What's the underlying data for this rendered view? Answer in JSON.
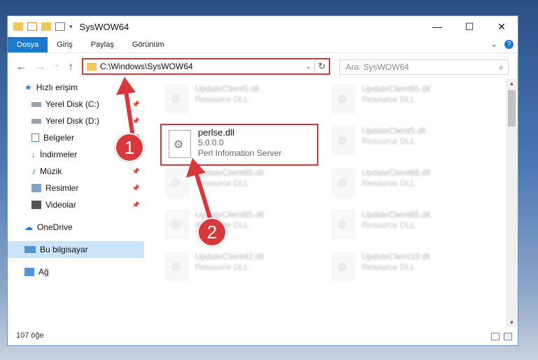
{
  "window": {
    "title": "SysWOW64",
    "controls": {
      "minimize": "—",
      "maximize": "☐",
      "close": "✕"
    }
  },
  "ribbon": {
    "tabs": [
      "Dosya",
      "Giriş",
      "Paylaş",
      "Görünüm"
    ],
    "expand": "⌄",
    "help": "?"
  },
  "nav": {
    "back": "←",
    "forward": "→",
    "recent": "⌄",
    "up": "↑"
  },
  "address": {
    "path": "C:\\Windows\\SysWOW64",
    "dropdown": "⌄",
    "refresh": "↻"
  },
  "search": {
    "placeholder": "Ara: SysWOW64",
    "icon": "search-icon"
  },
  "sidebar": {
    "quick_access": "Hızlı erişim",
    "items": [
      {
        "label": "Yerel Disk (C:)",
        "icon": "drive-icon",
        "pinned": true
      },
      {
        "label": "Yerel Disk (D:)",
        "icon": "drive-icon",
        "pinned": true
      },
      {
        "label": "Belgeler",
        "icon": "documents-icon",
        "pinned": true
      },
      {
        "label": "İndirmeler",
        "icon": "download-icon",
        "pinned": true
      },
      {
        "label": "Müzik",
        "icon": "music-icon",
        "pinned": true
      },
      {
        "label": "Resimler",
        "icon": "pictures-icon",
        "pinned": true
      },
      {
        "label": "Videolar",
        "icon": "videos-icon",
        "pinned": true
      }
    ],
    "onedrive": "OneDrive",
    "this_pc": "Bu bilgisayar",
    "network": "Ağ"
  },
  "files": {
    "left": [
      {
        "name": "UpdateClient5.dll",
        "type": "Resource DLL"
      },
      {
        "name": "perlse.dll",
        "version": "5.0.0.0",
        "description": "Perl Infomation Server"
      },
      {
        "name": "UpdateClient65.dll",
        "type": "Resource DLL"
      },
      {
        "name": "UpdateClient65.dll",
        "type": "Resource DLL"
      },
      {
        "name": "UpdateClient42.dll",
        "type": "Resource DLL"
      }
    ],
    "right": [
      {
        "name": "UpdateClient65.dll",
        "type": "Resource DLL"
      },
      {
        "name": "UpdateClient5.dll",
        "type": "Resource DLL"
      },
      {
        "name": "UpdateClient65.dll",
        "type": "Resource DLL"
      },
      {
        "name": "UpdateClient65.dll",
        "type": "Resource DLL"
      },
      {
        "name": "UpdateClient19.dll",
        "type": "Resource DLL"
      }
    ]
  },
  "status": {
    "count": "107 öğe"
  },
  "callouts": {
    "one": "1",
    "two": "2"
  },
  "colors": {
    "accent": "#1979ca",
    "highlight": "#d9383b",
    "selection": "#cce4f7"
  }
}
